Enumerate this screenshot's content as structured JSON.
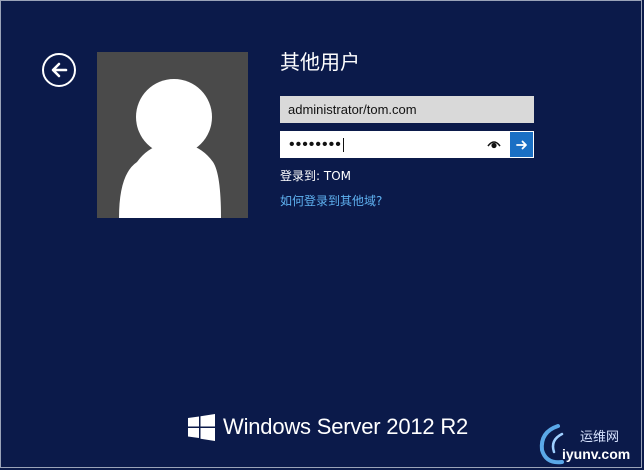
{
  "login": {
    "title": "其他用户",
    "username_value": "administrator/tom.com",
    "password_mask": "••••••••",
    "domain_prefix": "登录到: ",
    "domain": "TOM",
    "other_domain_link": "如何登录到其他域?"
  },
  "branding": {
    "product": "Windows Server",
    "version": "2012 R2"
  },
  "watermark": {
    "line1": "运维网",
    "line2": "iyunv.com"
  },
  "colors": {
    "background": "#0b1a4a",
    "avatar_bg": "#4a4a4a",
    "submit": "#1a6fc4",
    "link": "#5fb1f0"
  },
  "icons": {
    "back": "back-arrow-icon",
    "avatar": "user-silhouette-icon",
    "reveal": "eye-icon",
    "submit": "arrow-right-icon",
    "logo": "windows-logo-icon"
  }
}
